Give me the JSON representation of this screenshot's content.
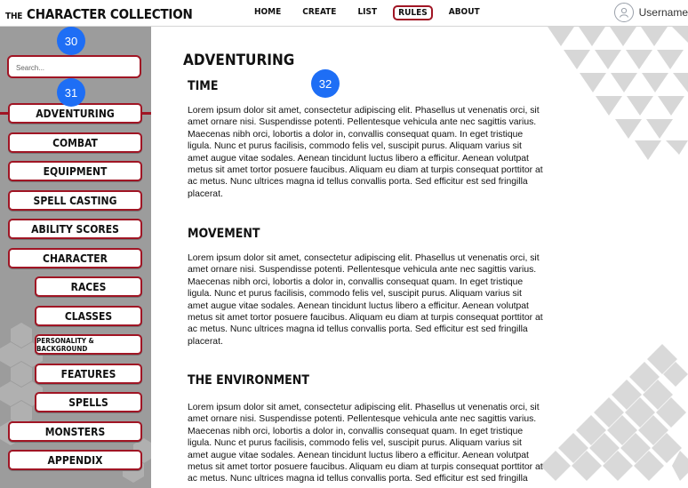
{
  "header": {
    "logo_small": "THE",
    "logo_big": "CHARACTER COLLECTION",
    "nav": [
      "HOME",
      "CREATE",
      "LIST",
      "RULES",
      "ABOUT"
    ],
    "active_nav": "RULES",
    "username": "Username"
  },
  "sidebar": {
    "search_placeholder": "Search...",
    "items": [
      {
        "label": "ADVENTURING"
      },
      {
        "label": "COMBAT"
      },
      {
        "label": "EQUIPMENT"
      },
      {
        "label": "SPELL CASTING"
      },
      {
        "label": "ABILITY SCORES"
      },
      {
        "label": "CHARACTER"
      },
      {
        "label": "RACES"
      },
      {
        "label": "CLASSES"
      },
      {
        "label": "PERSONALITY & BACKGROUND"
      },
      {
        "label": "FEATURES"
      },
      {
        "label": "SPELLS"
      },
      {
        "label": "MONSTERS"
      },
      {
        "label": "APPENDIX"
      }
    ]
  },
  "markers": [
    "30",
    "31",
    "32"
  ],
  "main": {
    "title": "ADVENTURING",
    "sections": [
      {
        "title": "TIME",
        "body": "Lorem ipsum dolor sit amet, consectetur adipiscing elit. Phasellus ut  venenatis orci, sit amet ornare nisi. Suspendisse potenti. Pellentesque  vehicula ante nec sagittis varius. Maecenas nibh orci, lobortis a dolor  in, convallis consequat quam. In eget tristique ligula. Nunc et purus  facilisis, commodo felis vel, suscipit purus. Aliquam varius sit amet augue vitae sodales. Aenean tincidunt luctus libero a efficitur. Aenean  volutpat metus sit amet tortor posuere faucibus. Aliquam eu diam at  turpis consequat porttitor at ac metus. Nunc ultrices magna id tellus  convallis porta. Sed efficitur est sed fringilla placerat."
      },
      {
        "title": "MOVEMENT",
        "body": "Lorem ipsum dolor sit amet, consectetur adipiscing elit. Phasellus ut  venenatis orci, sit amet ornare nisi. Suspendisse potenti. Pellentesque  vehicula ante nec sagittis varius. Maecenas nibh orci, lobortis a dolor  in, convallis consequat quam. In eget tristique ligula. Nunc et purus  facilisis, commodo felis vel, suscipit purus. Aliquam varius sit amet augue vitae sodales. Aenean tincidunt luctus libero a efficitur. Aenean  volutpat metus sit amet tortor posuere faucibus. Aliquam eu diam at  turpis consequat porttitor at ac metus. Nunc ultrices magna id tellus  convallis porta. Sed efficitur est sed fringilla placerat."
      },
      {
        "title": "THE ENVIRONMENT",
        "body": "Lorem ipsum dolor sit amet, consectetur adipiscing elit. Phasellus ut  venenatis orci, sit amet ornare nisi. Suspendisse potenti. Pellentesque  vehicula ante nec sagittis varius. Maecenas nibh orci, lobortis a dolor  in, convallis consequat quam. In eget tristique ligula. Nunc et purus  facilisis, commodo felis vel, suscipit purus. Aliquam varius sit amet augue vitae sodales. Aenean tincidunt luctus libero a efficitur. Aenean  volutpat metus sit amet tortor posuere faucibus. Aliquam eu diam at  turpis consequat porttitor at ac metus. Nunc ultrices magna id tellus  convallis porta. Sed efficitur est sed fringilla"
      }
    ]
  },
  "colors": {
    "accent": "#a01524",
    "marker": "#1e6ef5",
    "sidebar": "#9c9c9c"
  }
}
